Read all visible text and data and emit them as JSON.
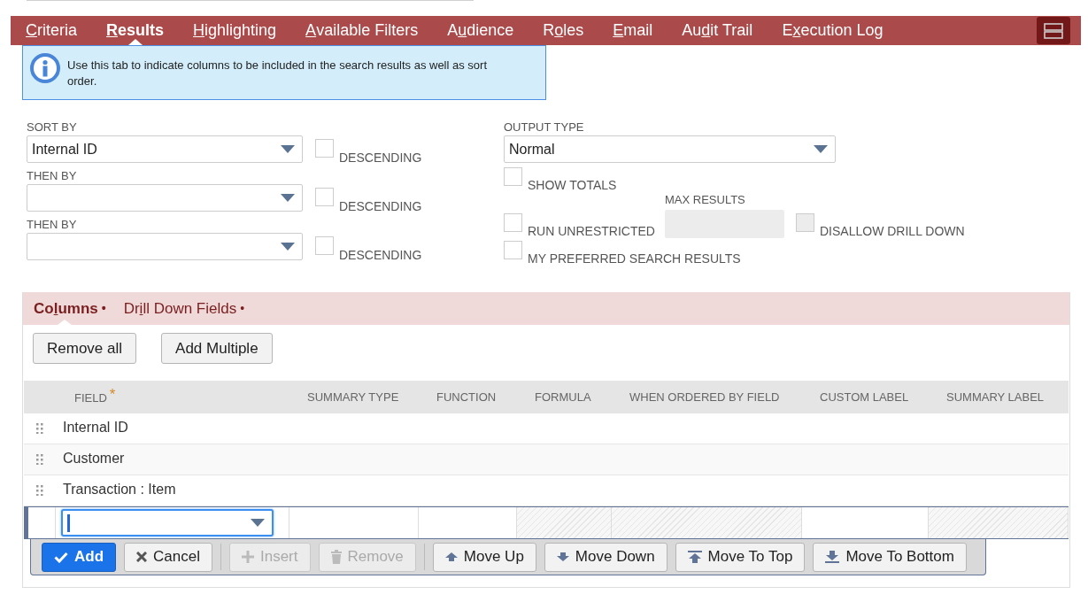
{
  "tabs": [
    {
      "label_parts": {
        "key": "C",
        "post": "riteria"
      },
      "selected": false
    },
    {
      "label_parts": {
        "key": "R",
        "post": "esults"
      },
      "selected": true
    },
    {
      "label_parts": {
        "key": "H",
        "post": "ighlighting"
      },
      "selected": false
    },
    {
      "label_parts": {
        "key": "A",
        "post": "vailable Filters"
      },
      "selected": false
    },
    {
      "label_parts": {
        "pre": "A",
        "key": "u",
        "post": "dience"
      },
      "selected": false
    },
    {
      "label_parts": {
        "pre": "R",
        "key": "o",
        "post": "les"
      },
      "selected": false
    },
    {
      "label_parts": {
        "key": "E",
        "post": "mail"
      },
      "selected": false
    },
    {
      "label_parts": {
        "pre": "Au",
        "key": "d",
        "post": "it Trail"
      },
      "selected": false
    },
    {
      "label_parts": {
        "pre": "E",
        "key": "x",
        "post": "ecution Log"
      },
      "selected": false
    }
  ],
  "info": "Use this tab to indicate columns to be included in the search results as well as sort order.",
  "sort": [
    {
      "label": "SORT BY",
      "value": "Internal ID",
      "descending": {
        "label": "DESCENDING",
        "checked": false
      }
    },
    {
      "label": "THEN BY",
      "descending": {
        "label": "DESCENDING",
        "checked": false
      }
    },
    {
      "label": "THEN BY",
      "descending": {
        "label": "DESCENDING",
        "checked": false
      }
    }
  ],
  "output_type": {
    "label": "OUTPUT TYPE",
    "value": "Normal"
  },
  "show_totals": {
    "label": "SHOW TOTALS",
    "checked": false
  },
  "run_unrestricted": {
    "label": "RUN UNRESTRICTED",
    "checked": false
  },
  "max_results": {
    "label": "MAX RESULTS",
    "disabled": true
  },
  "disallow_drill_down": {
    "label": "DISALLOW DRILL DOWN",
    "checked": false,
    "disabled": true
  },
  "my_preferred": {
    "label": "MY PREFERRED SEARCH RESULTS",
    "checked": false
  },
  "subtabs": [
    {
      "label_parts": {
        "pre": "Co",
        "key": "l",
        "post": "umns"
      },
      "dot": "•",
      "selected": true
    },
    {
      "label_parts": {
        "pre": "Dr",
        "key": "i",
        "post": "ll Down Fields"
      },
      "dot": "•",
      "selected": false
    }
  ],
  "actions": [
    "Remove all",
    "Add Multiple"
  ],
  "table": {
    "columns": [
      {
        "label": "FIELD",
        "required": "*"
      },
      {
        "label": "SUMMARY TYPE"
      },
      {
        "label": "FUNCTION"
      },
      {
        "label": "FORMULA"
      },
      {
        "label": "WHEN ORDERED BY FIELD"
      },
      {
        "label": "CUSTOM LABEL"
      },
      {
        "label": "SUMMARY LABEL"
      }
    ],
    "rows": [
      "Internal ID",
      "Customer",
      "Transaction : Item"
    ],
    "edit_row": [
      {
        "disabled": false
      },
      {
        "disabled": false
      },
      {
        "disabled": false
      },
      {
        "disabled": true
      },
      {
        "disabled": true
      },
      {
        "disabled": false
      },
      {
        "disabled": true
      }
    ]
  },
  "toolbar": [
    {
      "kind": "add",
      "label": "Add",
      "disabled": false
    },
    {
      "kind": "cancel",
      "label": "Cancel",
      "disabled": false
    },
    {
      "kind": "insert",
      "label": "Insert",
      "disabled": true
    },
    {
      "kind": "remove",
      "label": "Remove",
      "disabled": true
    },
    {
      "kind": "up",
      "label": "Move Up",
      "disabled": false
    },
    {
      "kind": "down",
      "label": "Move Down",
      "disabled": false
    },
    {
      "kind": "top",
      "label": "Move To Top",
      "disabled": false
    },
    {
      "kind": "bottom",
      "label": "Move To Bottom",
      "disabled": false
    }
  ]
}
